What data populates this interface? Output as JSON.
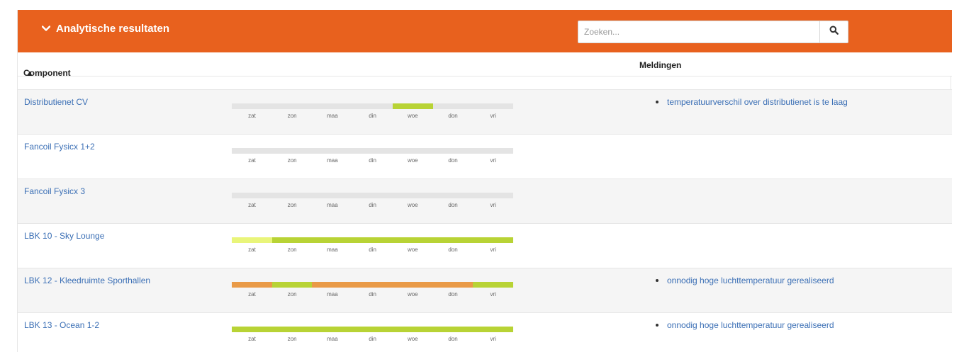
{
  "panel": {
    "title": "Analytische resultaten",
    "search": {
      "placeholder": "Zoeken...",
      "value": ""
    },
    "accent_color": "#e8611e"
  },
  "columns": {
    "component": "Component",
    "sort_indicator": "▲",
    "meldingen": "Meldingen"
  },
  "day_labels": [
    "zat",
    "zon",
    "maa",
    "din",
    "woe",
    "don",
    "vri"
  ],
  "status_colors": {
    "none": "#e4e4e4",
    "good": "#b8d335",
    "warning": "#e9f57a",
    "bad": "#e99a47"
  },
  "rows": [
    {
      "name": "Distributienet CV",
      "days": [
        "none",
        "none",
        "none",
        "none",
        "good",
        "none",
        "none"
      ],
      "meldingen": [
        "temperatuurverschil over distributienet is te laag"
      ]
    },
    {
      "name": "Fancoil Fysicx 1+2",
      "days": [
        "none",
        "none",
        "none",
        "none",
        "none",
        "none",
        "none"
      ],
      "meldingen": []
    },
    {
      "name": "Fancoil Fysicx 3",
      "days": [
        "none",
        "none",
        "none",
        "none",
        "none",
        "none",
        "none"
      ],
      "meldingen": []
    },
    {
      "name": "LBK 10 - Sky Lounge",
      "days": [
        "warning",
        "good",
        "good",
        "good",
        "good",
        "good",
        "good"
      ],
      "meldingen": []
    },
    {
      "name": "LBK 12 - Kleedruimte Sporthallen",
      "days": [
        "bad",
        "good",
        "bad",
        "bad",
        "bad",
        "bad",
        "good"
      ],
      "meldingen": [
        "onnodig hoge luchttemperatuur gerealiseerd"
      ]
    },
    {
      "name": "LBK 13 - Ocean 1-2",
      "days": [
        "good",
        "good",
        "good",
        "good",
        "good",
        "good",
        "good"
      ],
      "meldingen": [
        "onnodig hoge luchttemperatuur gerealiseerd"
      ]
    }
  ]
}
